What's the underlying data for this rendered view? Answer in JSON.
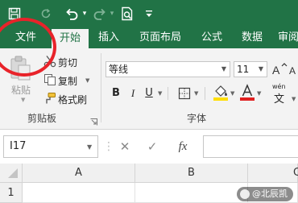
{
  "colors": {
    "brand_green": "#217346",
    "ribbon_bg": "#f3f3f3",
    "annotation_red": "#e8232a",
    "font_color_bar": "#e02020",
    "fill_color_bar": "#ffde00"
  },
  "quick_access": {
    "icons": [
      "save-icon",
      "redo-arrow-icon",
      "undo-icon",
      "redo-icon",
      "print-preview-icon",
      "customize-caret-icon"
    ]
  },
  "tabs": [
    {
      "label": "文件"
    },
    {
      "label": "开始"
    },
    {
      "label": "插入"
    },
    {
      "label": "页面布局"
    },
    {
      "label": "公式"
    },
    {
      "label": "数据"
    },
    {
      "label": "审阅"
    }
  ],
  "clipboard": {
    "paste_label": "粘贴",
    "cut_label": "剪切",
    "copy_label": "复制",
    "format_painter_label": "格式刷",
    "group_label": "剪贴板"
  },
  "font": {
    "font_name": "等线",
    "font_size": "11",
    "bold": "B",
    "italic": "I",
    "underline": "U",
    "font_color_letter": "A",
    "phonetic_label": "wén",
    "phonetic_char": "文",
    "group_label": "字体"
  },
  "formula_bar": {
    "name_box": "I17",
    "fx_label": "fx",
    "formula_value": ""
  },
  "grid": {
    "columns": [
      "A",
      "B",
      "C"
    ],
    "rows": [
      "1"
    ]
  },
  "watermark": {
    "text": "@北辰凯"
  }
}
